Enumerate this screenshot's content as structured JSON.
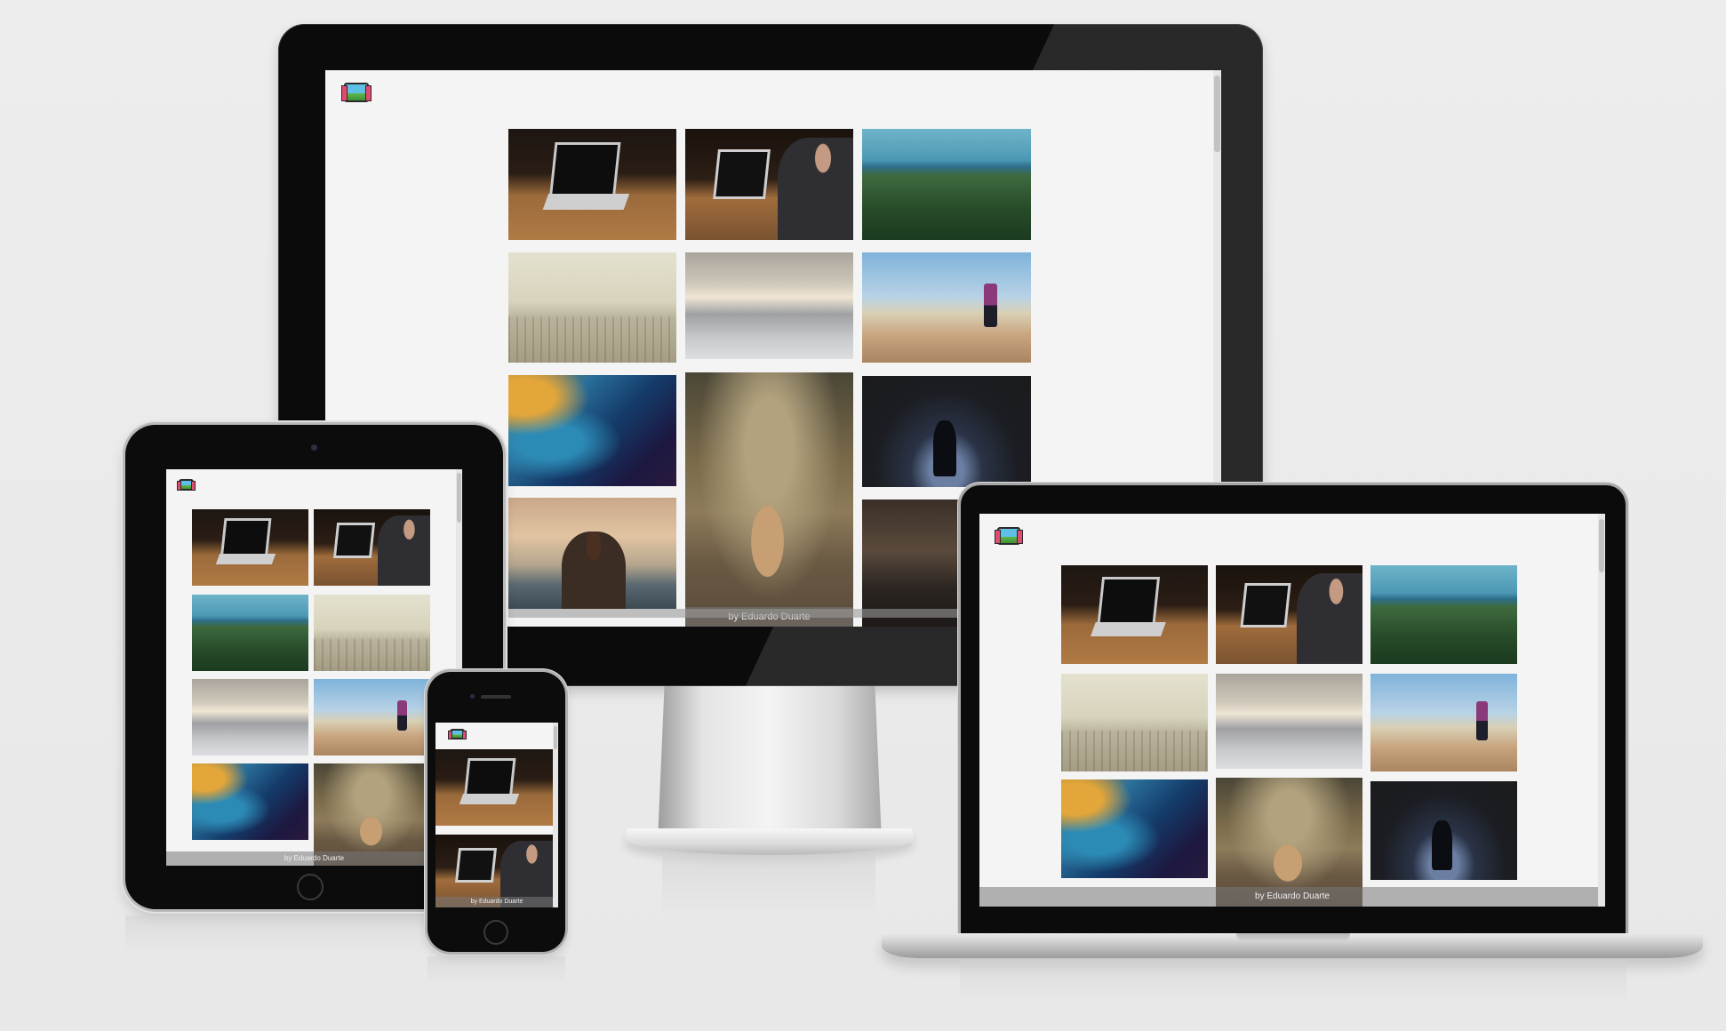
{
  "photo_credit": "by Eduardo Duarte",
  "devices": {
    "imac": {
      "logo": "gallery-logo-icon",
      "tiles": [
        "laptop-desk",
        "laptop-typing",
        "forest-sea",
        "foggy-beach",
        "sand-dunes",
        "beach-walker",
        "ocean-aerial",
        "deer-forest",
        "dark-puddle",
        "person-sunset",
        "living-room"
      ]
    },
    "tablet": {
      "logo": "gallery-logo-icon"
    },
    "phone": {
      "logo": "gallery-logo-icon"
    },
    "laptop": {
      "logo": "gallery-logo-icon"
    }
  },
  "colors": {
    "background": "#e9e9e9",
    "bezel": "#0b0b0b",
    "screen": "#f4f4f4"
  }
}
